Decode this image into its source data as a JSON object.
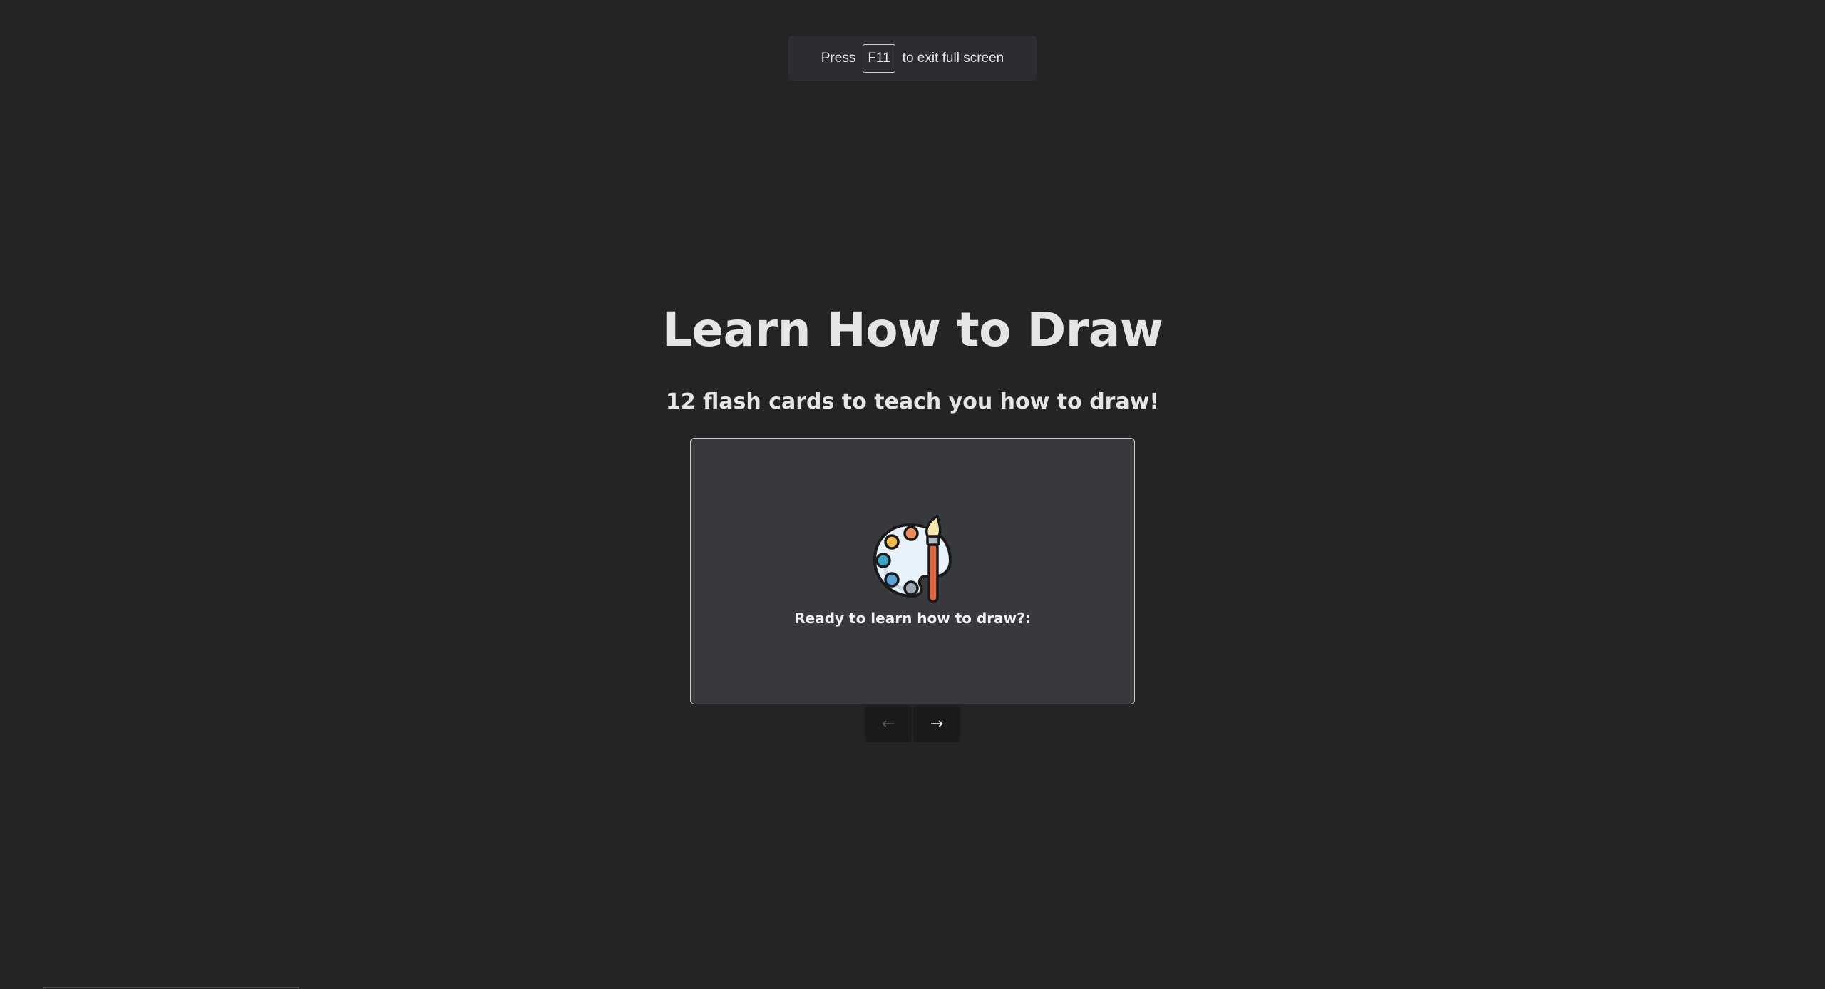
{
  "fullscreen_notice": {
    "prefix": "Press",
    "key": "F11",
    "suffix": "to exit full screen"
  },
  "page": {
    "title": "Learn How to Draw",
    "subtitle": "12 flash cards to teach you how to draw!"
  },
  "card": {
    "icon": "artist-palette-icon",
    "text": "Ready to learn how to draw?:"
  },
  "navigation": {
    "prev_label": "←",
    "next_label": "→"
  }
}
